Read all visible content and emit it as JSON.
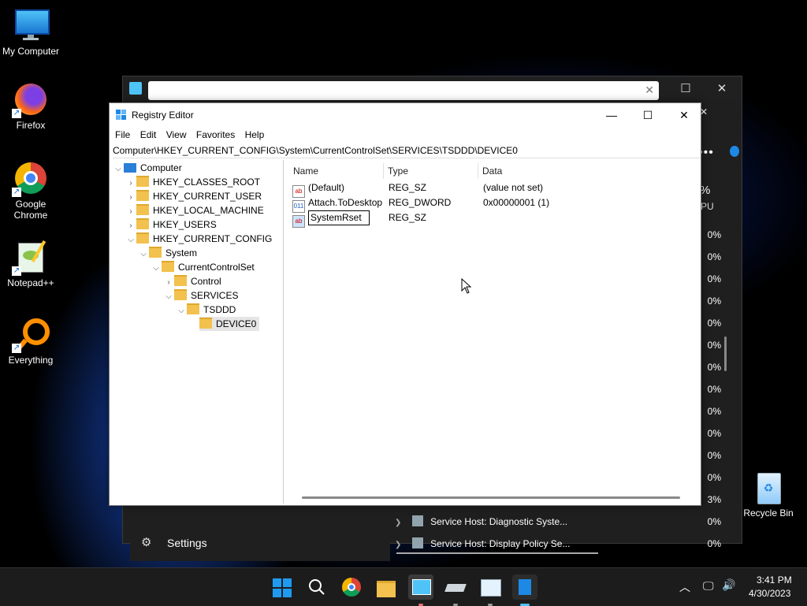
{
  "desktop": {
    "icons": [
      {
        "label": "My Computer"
      },
      {
        "label": "Firefox"
      },
      {
        "label": "Google Chrome"
      },
      {
        "label": "Notepad++"
      },
      {
        "label": "Everything"
      },
      {
        "label": "Recycle Bin"
      }
    ]
  },
  "task_manager": {
    "settings_label": "Settings",
    "column_fragment": "%",
    "column_fragment2": "PU",
    "percents": [
      "0%",
      "0%",
      "0%",
      "0%",
      "0%",
      "0%",
      "0%",
      "0%",
      "0%",
      "0%",
      "0%",
      "0%",
      "3%",
      "0%",
      "0%"
    ],
    "service_rows": [
      {
        "label": "Service Host: Diagnostic Syste..."
      },
      {
        "label": "Service Host: Display Policy Se..."
      }
    ]
  },
  "regedit": {
    "title": "Registry Editor",
    "menu": [
      "File",
      "Edit",
      "View",
      "Favorites",
      "Help"
    ],
    "address": "Computer\\HKEY_CURRENT_CONFIG\\System\\CurrentControlSet\\SERVICES\\TSDDD\\DEVICE0",
    "tree": [
      {
        "label": "Computer"
      },
      {
        "label": "HKEY_CLASSES_ROOT"
      },
      {
        "label": "HKEY_CURRENT_USER"
      },
      {
        "label": "HKEY_LOCAL_MACHINE"
      },
      {
        "label": "HKEY_USERS"
      },
      {
        "label": "HKEY_CURRENT_CONFIG"
      },
      {
        "label": "System"
      },
      {
        "label": "CurrentControlSet"
      },
      {
        "label": "Control"
      },
      {
        "label": "SERVICES"
      },
      {
        "label": "TSDDD"
      },
      {
        "label": "DEVICE0"
      }
    ],
    "columns": {
      "name": "Name",
      "type": "Type",
      "data": "Data"
    },
    "values": [
      {
        "name": "(Default)",
        "type": "REG_SZ",
        "data": "(value not set)",
        "icon": "string-value-icon"
      },
      {
        "name": "Attach.ToDesktop",
        "type": "REG_DWORD",
        "data": "0x00000001 (1)",
        "icon": "dword-value-icon"
      },
      {
        "name": "SystemRset",
        "type": "REG_SZ",
        "data": "",
        "icon": "string-value-icon"
      }
    ]
  },
  "taskbar": {
    "time": "3:41 PM",
    "date": "4/30/2023"
  },
  "colors": {
    "accent": "#0a64d8",
    "taskbar": "#1c1c1c"
  }
}
